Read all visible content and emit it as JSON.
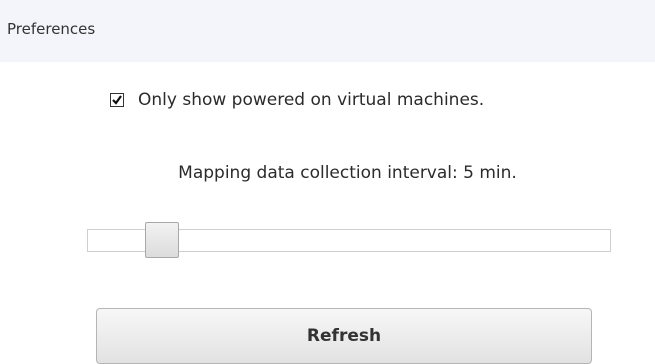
{
  "header": {
    "title": "Preferences"
  },
  "checkbox": {
    "label": "Only show powered on virtual machines.",
    "checked": true
  },
  "interval": {
    "text": "Mapping data collection interval: 5 min.",
    "slider_value_min": 5
  },
  "refresh": {
    "label": "Refresh"
  }
}
